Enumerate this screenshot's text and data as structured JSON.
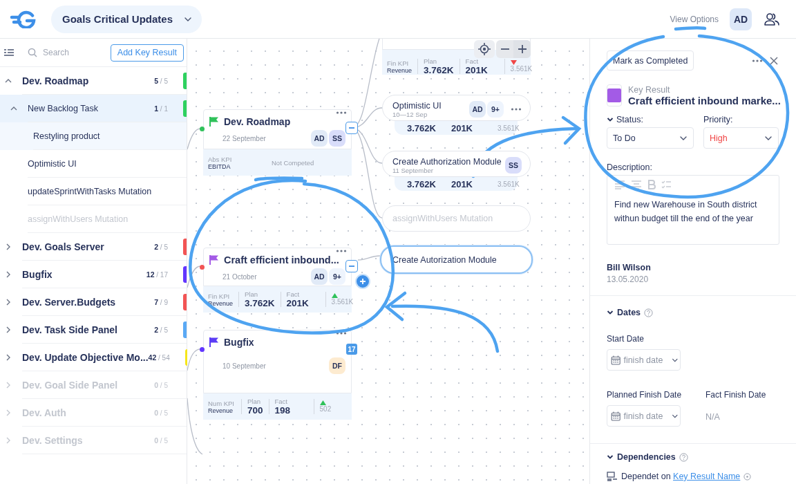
{
  "header": {
    "title": "Goals Critical Updates",
    "view_options": "View Options",
    "avatar": "AD"
  },
  "sidebar": {
    "search_placeholder": "Search",
    "add_button": "Add Key Result",
    "items": [
      {
        "label": "Dev. Roadmap",
        "done": "5",
        "total": "/ 5",
        "color": "#2ed15f",
        "expanded": true,
        "selected": false,
        "disabled": false,
        "children": [
          {
            "label": "New Backlog Task",
            "done": "1",
            "total": "/ 1",
            "color": "#2ed15f",
            "expanded": true,
            "selected": true,
            "disabled": false,
            "children": [
              {
                "label": "Restyling product",
                "selected": true,
                "disabled": false
              }
            ]
          },
          {
            "label": "Optimistic UI",
            "selected": false,
            "disabled": false
          },
          {
            "label": "updateSprintWithTasks Mutation",
            "selected": false,
            "disabled": false
          },
          {
            "label": "assignWithUsers Mutation",
            "selected": false,
            "disabled": true
          }
        ]
      },
      {
        "label": "Dev. Goals Server",
        "done": "2",
        "total": "/ 5",
        "color": "#f25454",
        "expanded": false,
        "selected": false,
        "disabled": false
      },
      {
        "label": "Bugfix",
        "done": "12",
        "total": "/ 17",
        "color": "#6236ff",
        "expanded": false,
        "selected": false,
        "disabled": false
      },
      {
        "label": "Dev. Server.Budgets",
        "done": "7",
        "total": "/ 9",
        "color": "#f25454",
        "expanded": false,
        "selected": false,
        "disabled": false
      },
      {
        "label": "Dev. Task Side Panel",
        "done": "2",
        "total": "/ 5",
        "color": "#5aa9f5",
        "expanded": false,
        "selected": false,
        "disabled": false
      },
      {
        "label": "Dev. Update Objective Mo...",
        "done": "42",
        "total": "/ 54",
        "color": "#f5e61a",
        "expanded": false,
        "selected": false,
        "disabled": false
      },
      {
        "label": "Dev. Goal Side Panel",
        "done": "0",
        "total": "/ 5",
        "expanded": false,
        "selected": false,
        "disabled": true
      },
      {
        "label": "Dev. Auth",
        "done": "0",
        "total": "/ 5",
        "expanded": false,
        "selected": false,
        "disabled": true
      },
      {
        "label": "Dev. Settings",
        "done": "0",
        "total": "/ 5",
        "expanded": false,
        "selected": false,
        "disabled": true
      }
    ]
  },
  "canvas": {
    "goals": [
      {
        "title": "Dev. Roadmap",
        "date": "22 September",
        "color": "#2fc15a",
        "dot": {
          "color": "#2fc15a"
        },
        "avatars": [
          {
            "text": "AD",
            "color": "#e1eaf7"
          },
          {
            "text": "SS",
            "color": "#d9ddfa"
          }
        ],
        "expanded": true,
        "adding": false,
        "kpi": {
          "kind": "status",
          "type": "Abs KPI",
          "metric": "EBITDA",
          "status": "Not Competed"
        }
      },
      {
        "title": "Craft efficient inbound...",
        "date": "21 October",
        "color": "#a35be6",
        "dot": {
          "color": "#f25454"
        },
        "avatars": [
          {
            "text": "AD",
            "color": "#e1eaf7"
          },
          {
            "text": "9+",
            "color": "#eef4fd"
          }
        ],
        "expanded": true,
        "adding": true,
        "kpi": {
          "kind": "values",
          "type": "Fin KPI",
          "metric": "Revenue",
          "plan_label": "Plan",
          "plan": "3.762K",
          "fact_label": "Fact",
          "fact": "201K",
          "rising": true,
          "delta": "3.561K"
        }
      },
      {
        "title": "Bugfix",
        "date": "10 September",
        "color": "#5b3df5",
        "dot": {
          "color": "#6236ff"
        },
        "avatars": [
          {
            "text": "DF",
            "color": "#fdebd0"
          }
        ],
        "expanded": false,
        "child_count": "17",
        "adding": false,
        "kpi": {
          "kind": "values",
          "type": "Num KPI",
          "metric": "Revenue",
          "plan_label": "Plan",
          "plan": "700",
          "fact_label": "Fact",
          "fact": "198",
          "rising": true,
          "delta": "502"
        }
      }
    ],
    "tasks": [
      {
        "kind": "card",
        "kpi": {
          "kind": "values",
          "type": "Fin KPI",
          "metric": "Revenue",
          "plan_label": "Plan",
          "plan": "3.762K",
          "fact_label": "Fact",
          "fact": "201K",
          "rising": false,
          "delta": "3.561K"
        }
      },
      {
        "kind": "task",
        "title": "Optimistic UI",
        "date": "10—12 Sep",
        "avatars": [
          {
            "text": "AD",
            "color": "#e1eaf7"
          },
          {
            "text": "9+",
            "color": "#eef4fd"
          }
        ],
        "menu": true,
        "disabled": false,
        "values": {
          "plan": "3.762K",
          "fact": "201K",
          "delta": "3.561K"
        }
      },
      {
        "kind": "task",
        "title": "Create Authorization Module",
        "date": "11 September",
        "avatars": [
          {
            "text": "SS",
            "color": "#d9ddfa"
          }
        ],
        "menu": false,
        "disabled": false,
        "values": {
          "plan": "3.762K",
          "fact": "201K",
          "delta": "3.561K"
        }
      },
      {
        "kind": "task",
        "title": "assignWithUsers Mutation",
        "disabled": true
      },
      {
        "kind": "editing",
        "value": "Create Autorization Module"
      }
    ]
  },
  "panel": {
    "complete_button": "Mark as Completed",
    "type_label": "Key Result",
    "color": "#a35be6",
    "title": "Craft efficient inbound marke...",
    "status": {
      "label": "Status:",
      "value": "To Do"
    },
    "priority": {
      "label": "Priority:",
      "value": "High",
      "urgent": true
    },
    "description": {
      "label": "Description:",
      "text": "Find new Warehouse in South district withun budget till the end of the year"
    },
    "author": {
      "name": "Bill Wilson",
      "date": "13.05.2020"
    },
    "dates": {
      "title": "Dates",
      "start": {
        "label": "Start Date",
        "placeholder": "finish date"
      },
      "planned": {
        "label": "Planned Finish Date",
        "placeholder": "finish date"
      },
      "fact": {
        "label": "Fact Finish Date",
        "value": "N/A"
      }
    },
    "dependencies": {
      "title": "Dependencies",
      "text": "Dependet on",
      "link": "Key Result Name"
    }
  }
}
